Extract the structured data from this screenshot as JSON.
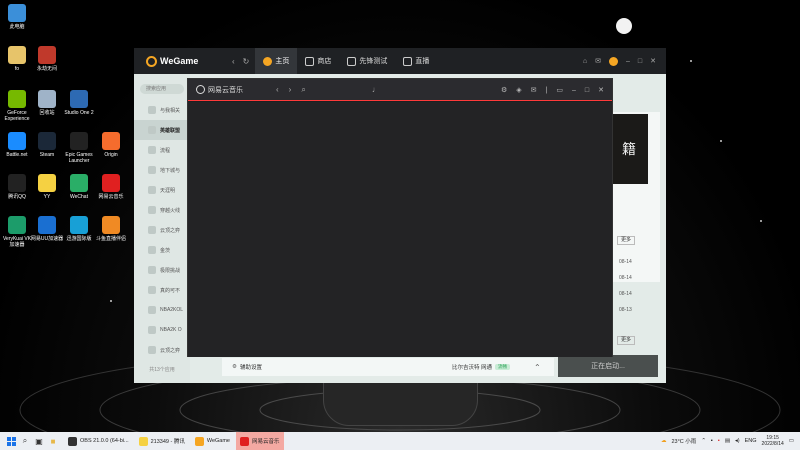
{
  "desktop": {
    "icons": [
      {
        "label": "此电脑",
        "color": "#3b8fd9"
      },
      {
        "label": "fo",
        "color": "#e7c46a"
      },
      {
        "label": "永劫无间",
        "color": "#c0392b"
      },
      {
        "label": "GeForce Experience",
        "color": "#76b900"
      },
      {
        "label": "回收站",
        "color": "#9fb3c8"
      },
      {
        "label": "Studio One 2",
        "color": "#2d6ab3"
      },
      {
        "label": "Battle.net",
        "color": "#1a8cff"
      },
      {
        "label": "Steam",
        "color": "#1b2838"
      },
      {
        "label": "Epic Games Launcher",
        "color": "#222222"
      },
      {
        "label": "Origin",
        "color": "#f56c2d"
      },
      {
        "label": "腾讯QQ",
        "color": "#222222"
      },
      {
        "label": "YY",
        "color": "#f5d142"
      },
      {
        "label": "WeChat",
        "color": "#2aae67"
      },
      {
        "label": "网易云音乐",
        "color": "#e02020"
      },
      {
        "label": "VeryKuai VK 加速器",
        "color": "#1c9c6a"
      },
      {
        "label": "网易UU加速器",
        "color": "#1a6fd1"
      },
      {
        "label": "迅游国际版",
        "color": "#18a0d6"
      },
      {
        "label": "斗鱼直播伴侣",
        "color": "#f08a24"
      }
    ]
  },
  "wegame": {
    "brand": "WeGame",
    "tabs": [
      {
        "label": "主页",
        "active": true
      },
      {
        "label": "商店",
        "active": false
      },
      {
        "label": "先锋测试",
        "active": false
      },
      {
        "label": "直播",
        "active": false
      }
    ],
    "sidebar": {
      "search_placeholder": "搜索应用",
      "items": [
        {
          "label": "与我相关",
          "active": false
        },
        {
          "label": "英雄联盟",
          "active": true
        },
        {
          "label": "流程",
          "active": false
        },
        {
          "label": "地下城与",
          "active": false
        },
        {
          "label": "天涯明",
          "active": false
        },
        {
          "label": "穿越火线",
          "active": false
        },
        {
          "label": "云顶之弈",
          "active": false
        },
        {
          "label": "金茨",
          "active": false
        },
        {
          "label": "极限挑战",
          "active": false
        },
        {
          "label": "真的可不",
          "active": false
        },
        {
          "label": "NBA2KOL",
          "active": false
        },
        {
          "label": "NBA2K O",
          "active": false
        },
        {
          "label": "云顶之弈",
          "active": false
        }
      ],
      "count_label": "共13个应用"
    },
    "main": {
      "promo_text": "籍",
      "more_label": "更多",
      "news_dates": [
        "08-14",
        "08-14",
        "08-14",
        "08-13"
      ],
      "more_label_2": "更多"
    },
    "launch_label": "正在启动..."
  },
  "netease": {
    "title": "网易云音乐"
  },
  "game_bar": {
    "settings_label": "辅助设置",
    "server_label": "比尔吉沃特 网通",
    "status_tag": "流畅"
  },
  "taskbar": {
    "apps": [
      {
        "label": "OBS 21.0.0 (64-bi...",
        "color": "#333333",
        "active": false
      },
      {
        "label": "213349 - 腾讯",
        "color": "#f5d142",
        "active": false
      },
      {
        "label": "WeGame",
        "color": "#f5a623",
        "active": false
      },
      {
        "label": "网易云音乐",
        "color": "#e02020",
        "active": true
      }
    ],
    "weather": "23°C 小雨",
    "lang": "ENG",
    "time": "19:15",
    "date": "2022/8/14"
  }
}
